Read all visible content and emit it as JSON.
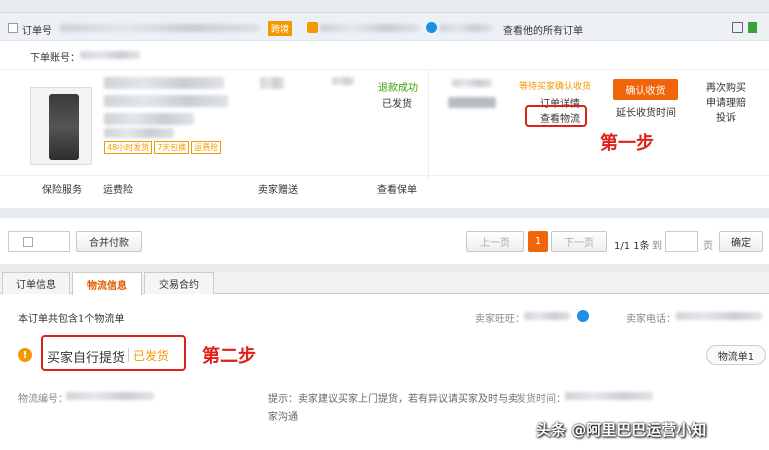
{
  "order_header": {
    "order_no_label": "订单号",
    "cross_border_badge": "跨境",
    "view_all_orders": "查看他的所有订单"
  },
  "buyer": {
    "account_label": "下单账号："
  },
  "product": {
    "tags": [
      "48小时发货",
      "7天包换",
      "运费险"
    ],
    "refund_status": "退款成功",
    "ship_status": "已发货"
  },
  "order_status": {
    "waiting_text": "等待买家确认收货",
    "detail_link": "订单详情",
    "logistics_link": "查看物流",
    "confirm_button": "确认收货",
    "extend_link": "延长收货时间",
    "rebuy": "再次购买",
    "claim": "申请理赔",
    "complain": "投诉"
  },
  "services": {
    "insurance": "保险服务",
    "freight_insurance": "运费险",
    "seller_gift": "卖家赠送",
    "view_policy": "查看保单"
  },
  "annotations": {
    "step1": "第一步",
    "step2": "第二步"
  },
  "pager": {
    "merge_pay": "合并付款",
    "prev": "上一页",
    "current": "1",
    "next": "下一页",
    "summary": "1/1 1条",
    "goto": "到",
    "page_unit": "页",
    "confirm": "确定"
  },
  "detail_tabs": [
    "订单信息",
    "物流信息",
    "交易合约"
  ],
  "logistics": {
    "count_text": "本订单共包含1个物流单",
    "seller_ww_label": "卖家旺旺：",
    "seller_phone_label": "卖家电话：",
    "method": "买家自行提货",
    "shipped": "已发货",
    "bill_button": "物流单1",
    "logistics_no_label": "物流编号：",
    "tip_line1": "提示：卖家建议买家上门提货，若有异议请买家及时与卖",
    "tip_line2": "家沟通",
    "ship_time_label": "发货时间："
  },
  "watermark": "头条 @阿里巴巴运营小知",
  "colors": {
    "accent": "#f39800",
    "annotation_red": "#e0201a",
    "active_tab": "#e05a00",
    "refund_green": "#39a300",
    "link_blue": "#1c5fa8"
  }
}
